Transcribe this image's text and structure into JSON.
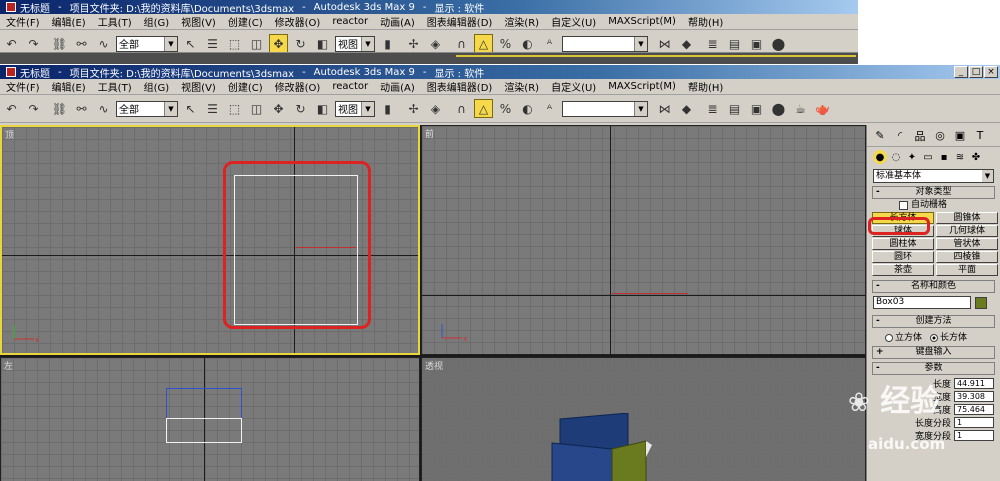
{
  "back_window": {
    "title": "无标题",
    "project_path": "项目文件夹: D:\\我的资料库\\Documents\\3dsmax",
    "app_name": "Autodesk 3ds Max 9",
    "display_mode": "显示 : 软件",
    "menu": [
      "文件(F)",
      "编辑(E)",
      "工具(T)",
      "组(G)",
      "视图(V)",
      "创建(C)",
      "修改器(O)",
      "reactor",
      "动画(A)",
      "图表编辑器(D)",
      "渲染(R)",
      "自定义(U)",
      "MAXScript(M)",
      "帮助(H)"
    ],
    "selection_filter": "全部",
    "ref_coord": "视图"
  },
  "front_window": {
    "title": "无标题",
    "project_path": "项目文件夹: D:\\我的资料库\\Documents\\3dsmax",
    "app_name": "Autodesk 3ds Max 9",
    "display_mode": "显示 : 软件",
    "menu": [
      "文件(F)",
      "编辑(E)",
      "工具(T)",
      "组(G)",
      "视图(V)",
      "创建(C)",
      "修改器(O)",
      "reactor",
      "动画(A)",
      "图表编辑器(D)",
      "渲染(R)",
      "自定义(U)",
      "MAXScript(M)",
      "帮助(H)"
    ],
    "selection_filter": "全部",
    "ref_coord": "视图",
    "win_controls": [
      "_",
      "□",
      "×"
    ]
  },
  "viewports": {
    "top_label": "顶",
    "front_label": "前",
    "left_label": "左",
    "perspective_label": "透视"
  },
  "command_panel": {
    "category": "标准基本体",
    "object_type": {
      "header": "对象类型",
      "autogrid": "自动栅格",
      "buttons": [
        "长方体",
        "圆锥体",
        "球体",
        "几何球体",
        "圆柱体",
        "管状体",
        "圆环",
        "四棱锥",
        "茶壶",
        "平面"
      ],
      "selected": "长方体"
    },
    "name_color": {
      "header": "名称和颜色",
      "name": "Box03",
      "color": "#6a7a1e"
    },
    "creation_method": {
      "header": "创建方法",
      "options": [
        "立方体",
        "长方体"
      ],
      "selected": "长方体"
    },
    "keyboard_entry": {
      "header": "键盘输入"
    },
    "parameters": {
      "header": "参数",
      "fields": [
        {
          "label": "长度",
          "value": "44.911"
        },
        {
          "label": "宽度",
          "value": "39.308"
        },
        {
          "label": "高度",
          "value": "75.464"
        },
        {
          "label": "长度分段",
          "value": "1"
        },
        {
          "label": "宽度分段",
          "value": "1"
        }
      ]
    }
  },
  "watermark": {
    "brand": "经验",
    "site": "aidu.com"
  }
}
